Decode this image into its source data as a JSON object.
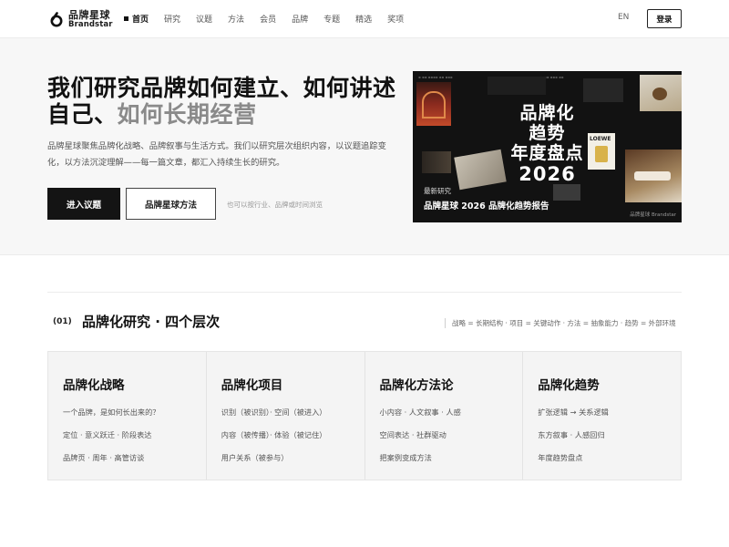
{
  "header": {
    "logo_cn": "品牌星球",
    "logo_en": "Brandstar",
    "nav": [
      "首页",
      "研究",
      "议题",
      "方法",
      "会员",
      "品牌",
      "专题",
      "精选",
      "奖项"
    ],
    "active_nav": "首页",
    "lang": "EN",
    "login": "登录"
  },
  "hero": {
    "title_main": "我们研究品牌如何建立、如何讲述自己、",
    "title_muted": "如何长期经营",
    "desc": "品牌星球聚焦品牌化战略、品牌叙事与生活方式。我们以研究层次组织内容，以议题追踪变化，以方法沉淀理解——每一篇文章，都汇入持续生长的研究。",
    "primary_btn": "进入议题",
    "secondary_btn": "品牌星球方法",
    "hint": "也可以按行业、品牌或时间浏览",
    "card": {
      "title_line1": "品牌化",
      "title_line2": "趋势",
      "title_line3": "年度盘点",
      "year": "2026",
      "kicker": "最新研究",
      "caption": "品牌星球 2026 品牌化趋势报告",
      "brand": "品牌星球 Brandstar",
      "thumb_label": "LOEWE"
    }
  },
  "section": {
    "num": "(01)",
    "title": "品牌化研究 · 四个层次",
    "legend": "战略 = 长期结构 · 项目 = 关键动作 · 方法 = 抽象能力 · 趋势 = 外部环境",
    "columns": [
      {
        "title": "品牌化战略",
        "items": [
          "一个品牌，是如何长出来的？",
          "定位 · 意义跃迁 · 阶段表达",
          "品牌页 · 周年 · 高管访谈"
        ]
      },
      {
        "title": "品牌化项目",
        "items": [
          "识别（被识别）· 空间（被进入）",
          "内容（被传播）· 体验（被记住）",
          "用户关系（被参与）"
        ]
      },
      {
        "title": "品牌化方法论",
        "items": [
          "小内容 · 人文叙事 · 人感",
          "空间表达 · 社群驱动",
          "把案例变成方法"
        ]
      },
      {
        "title": "品牌化趋势",
        "items": [
          "扩张逻辑 → 关系逻辑",
          "东方叙事 · 人感回归",
          "年度趋势盘点"
        ]
      }
    ]
  }
}
